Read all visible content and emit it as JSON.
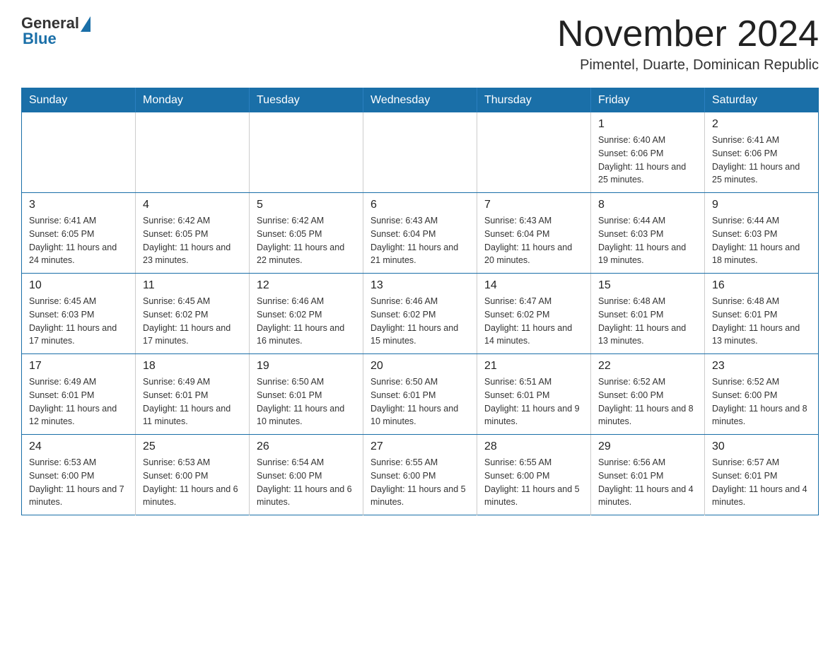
{
  "logo": {
    "general": "General",
    "blue": "Blue"
  },
  "header": {
    "title": "November 2024",
    "location": "Pimentel, Duarte, Dominican Republic"
  },
  "days_of_week": [
    "Sunday",
    "Monday",
    "Tuesday",
    "Wednesday",
    "Thursday",
    "Friday",
    "Saturday"
  ],
  "weeks": [
    [
      {
        "day": "",
        "info": ""
      },
      {
        "day": "",
        "info": ""
      },
      {
        "day": "",
        "info": ""
      },
      {
        "day": "",
        "info": ""
      },
      {
        "day": "",
        "info": ""
      },
      {
        "day": "1",
        "info": "Sunrise: 6:40 AM\nSunset: 6:06 PM\nDaylight: 11 hours and 25 minutes."
      },
      {
        "day": "2",
        "info": "Sunrise: 6:41 AM\nSunset: 6:06 PM\nDaylight: 11 hours and 25 minutes."
      }
    ],
    [
      {
        "day": "3",
        "info": "Sunrise: 6:41 AM\nSunset: 6:05 PM\nDaylight: 11 hours and 24 minutes."
      },
      {
        "day": "4",
        "info": "Sunrise: 6:42 AM\nSunset: 6:05 PM\nDaylight: 11 hours and 23 minutes."
      },
      {
        "day": "5",
        "info": "Sunrise: 6:42 AM\nSunset: 6:05 PM\nDaylight: 11 hours and 22 minutes."
      },
      {
        "day": "6",
        "info": "Sunrise: 6:43 AM\nSunset: 6:04 PM\nDaylight: 11 hours and 21 minutes."
      },
      {
        "day": "7",
        "info": "Sunrise: 6:43 AM\nSunset: 6:04 PM\nDaylight: 11 hours and 20 minutes."
      },
      {
        "day": "8",
        "info": "Sunrise: 6:44 AM\nSunset: 6:03 PM\nDaylight: 11 hours and 19 minutes."
      },
      {
        "day": "9",
        "info": "Sunrise: 6:44 AM\nSunset: 6:03 PM\nDaylight: 11 hours and 18 minutes."
      }
    ],
    [
      {
        "day": "10",
        "info": "Sunrise: 6:45 AM\nSunset: 6:03 PM\nDaylight: 11 hours and 17 minutes."
      },
      {
        "day": "11",
        "info": "Sunrise: 6:45 AM\nSunset: 6:02 PM\nDaylight: 11 hours and 17 minutes."
      },
      {
        "day": "12",
        "info": "Sunrise: 6:46 AM\nSunset: 6:02 PM\nDaylight: 11 hours and 16 minutes."
      },
      {
        "day": "13",
        "info": "Sunrise: 6:46 AM\nSunset: 6:02 PM\nDaylight: 11 hours and 15 minutes."
      },
      {
        "day": "14",
        "info": "Sunrise: 6:47 AM\nSunset: 6:02 PM\nDaylight: 11 hours and 14 minutes."
      },
      {
        "day": "15",
        "info": "Sunrise: 6:48 AM\nSunset: 6:01 PM\nDaylight: 11 hours and 13 minutes."
      },
      {
        "day": "16",
        "info": "Sunrise: 6:48 AM\nSunset: 6:01 PM\nDaylight: 11 hours and 13 minutes."
      }
    ],
    [
      {
        "day": "17",
        "info": "Sunrise: 6:49 AM\nSunset: 6:01 PM\nDaylight: 11 hours and 12 minutes."
      },
      {
        "day": "18",
        "info": "Sunrise: 6:49 AM\nSunset: 6:01 PM\nDaylight: 11 hours and 11 minutes."
      },
      {
        "day": "19",
        "info": "Sunrise: 6:50 AM\nSunset: 6:01 PM\nDaylight: 11 hours and 10 minutes."
      },
      {
        "day": "20",
        "info": "Sunrise: 6:50 AM\nSunset: 6:01 PM\nDaylight: 11 hours and 10 minutes."
      },
      {
        "day": "21",
        "info": "Sunrise: 6:51 AM\nSunset: 6:01 PM\nDaylight: 11 hours and 9 minutes."
      },
      {
        "day": "22",
        "info": "Sunrise: 6:52 AM\nSunset: 6:00 PM\nDaylight: 11 hours and 8 minutes."
      },
      {
        "day": "23",
        "info": "Sunrise: 6:52 AM\nSunset: 6:00 PM\nDaylight: 11 hours and 8 minutes."
      }
    ],
    [
      {
        "day": "24",
        "info": "Sunrise: 6:53 AM\nSunset: 6:00 PM\nDaylight: 11 hours and 7 minutes."
      },
      {
        "day": "25",
        "info": "Sunrise: 6:53 AM\nSunset: 6:00 PM\nDaylight: 11 hours and 6 minutes."
      },
      {
        "day": "26",
        "info": "Sunrise: 6:54 AM\nSunset: 6:00 PM\nDaylight: 11 hours and 6 minutes."
      },
      {
        "day": "27",
        "info": "Sunrise: 6:55 AM\nSunset: 6:00 PM\nDaylight: 11 hours and 5 minutes."
      },
      {
        "day": "28",
        "info": "Sunrise: 6:55 AM\nSunset: 6:00 PM\nDaylight: 11 hours and 5 minutes."
      },
      {
        "day": "29",
        "info": "Sunrise: 6:56 AM\nSunset: 6:01 PM\nDaylight: 11 hours and 4 minutes."
      },
      {
        "day": "30",
        "info": "Sunrise: 6:57 AM\nSunset: 6:01 PM\nDaylight: 11 hours and 4 minutes."
      }
    ]
  ]
}
